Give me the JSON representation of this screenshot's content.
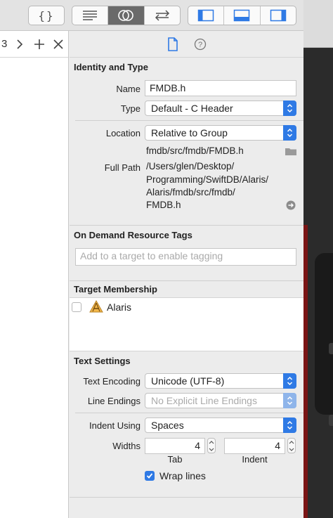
{
  "toolbar": {
    "editor_buttons": {
      "braces_icon": "curly-braces-icon",
      "standard_icon": "lines-icon",
      "assistant_icon": "venn-icon",
      "version_icon": "arrows-icon"
    },
    "layout_buttons": {
      "navigator_icon": "left-panel-icon",
      "debug_icon": "bottom-panel-icon",
      "utilities_icon": "right-panel-icon"
    }
  },
  "editor": {
    "jump_text": "3"
  },
  "inspector": {
    "identity": {
      "title": "Identity and Type",
      "name_label": "Name",
      "name_value": "FMDB.h",
      "type_label": "Type",
      "type_value": "Default - C Header",
      "location_label": "Location",
      "location_value": "Relative to Group",
      "relative_path": "fmdb/src/fmdb/FMDB.h",
      "full_path_label": "Full Path",
      "full_path_lines": [
        "/Users/glen/Desktop/",
        "Programming/SwiftDB/Alaris/",
        "Alaris/fmdb/src/fmdb/",
        "FMDB.h"
      ]
    },
    "tags": {
      "title": "On Demand Resource Tags",
      "placeholder": "Add to a target to enable tagging"
    },
    "membership": {
      "title": "Target Membership",
      "target_name": "Alaris",
      "checked": false
    },
    "text_settings": {
      "title": "Text Settings",
      "encoding_label": "Text Encoding",
      "encoding_value": "Unicode (UTF-8)",
      "line_endings_label": "Line Endings",
      "line_endings_value": "No Explicit Line Endings",
      "indent_label": "Indent Using",
      "indent_value": "Spaces",
      "widths_label": "Widths",
      "tab_value": "4",
      "tab_label": "Tab",
      "indent_value_num": "4",
      "indent_width_label": "Indent",
      "wrap_label": "Wrap lines",
      "wrap_checked": true
    }
  },
  "colors": {
    "accent": "#2f7ae5",
    "panel": "#ececec"
  }
}
